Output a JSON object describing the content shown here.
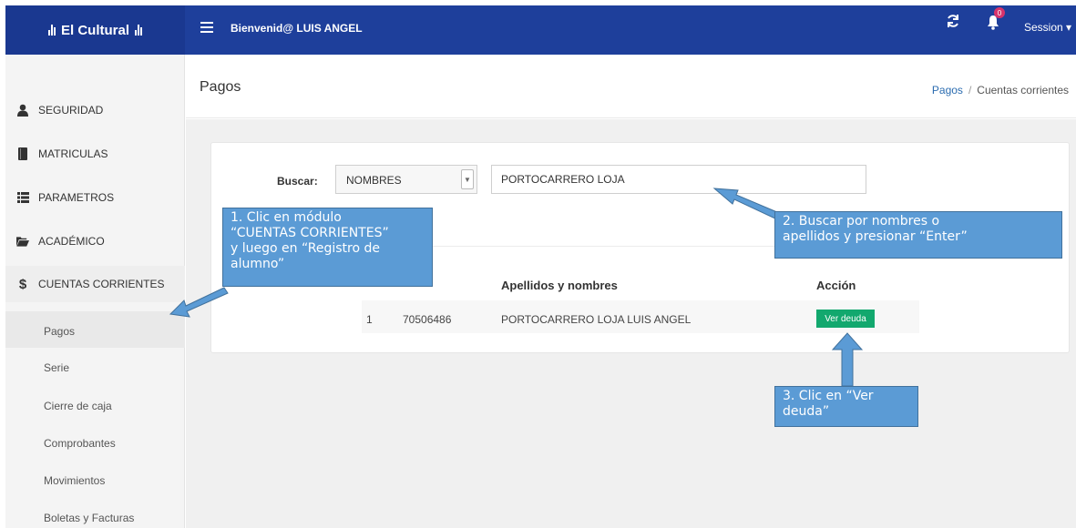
{
  "topbar": {
    "brand": "El Cultural",
    "welcome": "Bienvenid@ LUIS ANGEL",
    "notification_count": "0",
    "session_label": "Session ▾",
    "colors": {
      "navbar": "#1e3f9b",
      "brand_bg": "#1a3890"
    }
  },
  "sidebar": {
    "items": [
      {
        "label": "SEGURIDAD",
        "icon": "user-icon"
      },
      {
        "label": "MATRICULAS",
        "icon": "book-icon"
      },
      {
        "label": "PARAMETROS",
        "icon": "list-icon"
      },
      {
        "label": "ACADÉMICO",
        "icon": "folder-open-icon"
      },
      {
        "label": "CUENTAS CORRIENTES",
        "icon": "dollar-icon"
      }
    ],
    "subitems": [
      "Pagos",
      "Serie",
      "Cierre de caja",
      "Comprobantes",
      "Movimientos",
      "Boletas y Facturas"
    ]
  },
  "header": {
    "title": "Pagos",
    "breadcrumb": {
      "link": "Pagos",
      "separator": "/",
      "current": "Cuentas corrientes"
    }
  },
  "search": {
    "label": "Buscar:",
    "select_value": "NOMBRES",
    "input_value": "PORTOCARRERO LOJA"
  },
  "table": {
    "headers": [
      "Apellidos y nombres",
      "Acción"
    ],
    "rows": [
      {
        "index": "1",
        "code": "70506486",
        "name": "PORTOCARRERO LOJA LUIS ANGEL",
        "action": "Ver deuda"
      }
    ],
    "colors": {
      "action_button": "#12a86e"
    }
  },
  "callouts": {
    "step1": [
      "1. Clic en módulo",
      "“CUENTAS CORRIENTES”",
      "y luego en “Registro de",
      "alumno”"
    ],
    "step2": [
      "2. Buscar por nombres o",
      "apellidos y presionar “Enter”"
    ],
    "step3": [
      "3. Clic en “Ver",
      "deuda”"
    ],
    "colors": {
      "fill": "#5b9bd5",
      "border": "#41719c"
    }
  }
}
